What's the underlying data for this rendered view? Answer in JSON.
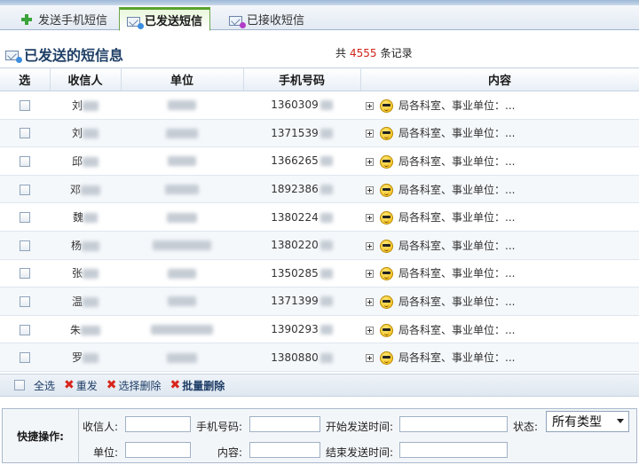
{
  "tabs": [
    {
      "label": "发送手机短信",
      "icon": "plus-icon",
      "active": false
    },
    {
      "label": "已发送短信",
      "icon": "envelope-out-icon",
      "active": true
    },
    {
      "label": "已接收短信",
      "icon": "envelope-in-icon",
      "active": false
    }
  ],
  "header": {
    "title": "已发送的短信息",
    "count_prefix": "共",
    "count_value": "4555",
    "count_suffix": "条记录"
  },
  "table": {
    "columns": [
      "选",
      "收信人",
      "单位",
      "手机号码",
      "内容"
    ],
    "rows": [
      {
        "recipient": "刘",
        "phone": "1360309",
        "content": "局各科室、事业单位：..."
      },
      {
        "recipient": "刘",
        "phone": "1371539",
        "content": "局各科室、事业单位：..."
      },
      {
        "recipient": "邱",
        "phone": "1366265",
        "content": "局各科室、事业单位：..."
      },
      {
        "recipient": "邓",
        "phone": "1892386",
        "content": "局各科室、事业单位：..."
      },
      {
        "recipient": "魏",
        "phone": "1380224",
        "content": "局各科室、事业单位：..."
      },
      {
        "recipient": "杨",
        "phone": "1380220",
        "content": "局各科室、事业单位：..."
      },
      {
        "recipient": "张",
        "phone": "1350285",
        "content": "局各科室、事业单位：..."
      },
      {
        "recipient": "温",
        "phone": "1371399",
        "content": "局各科室、事业单位：..."
      },
      {
        "recipient": "朱",
        "phone": "1390293",
        "content": "局各科室、事业单位：..."
      },
      {
        "recipient": "罗",
        "phone": "1380880",
        "content": "局各科室、事业单位：..."
      }
    ]
  },
  "actions": {
    "select_all": "全选",
    "resend": "重发",
    "delete_selected": "选择删除",
    "batch_delete": "批量删除"
  },
  "quick": {
    "label": "快捷操作:",
    "recipient": "收信人:",
    "phone": "手机号码:",
    "start_time": "开始发送时间:",
    "status": "状态:",
    "status_value": "所有类型",
    "unit": "单位:",
    "content": "内容:",
    "end_time": "结束发送时间:"
  },
  "colors": {
    "accent": "#59a32e",
    "title": "#1f3f66",
    "count": "#d0241b",
    "delete": "#d8261c"
  }
}
